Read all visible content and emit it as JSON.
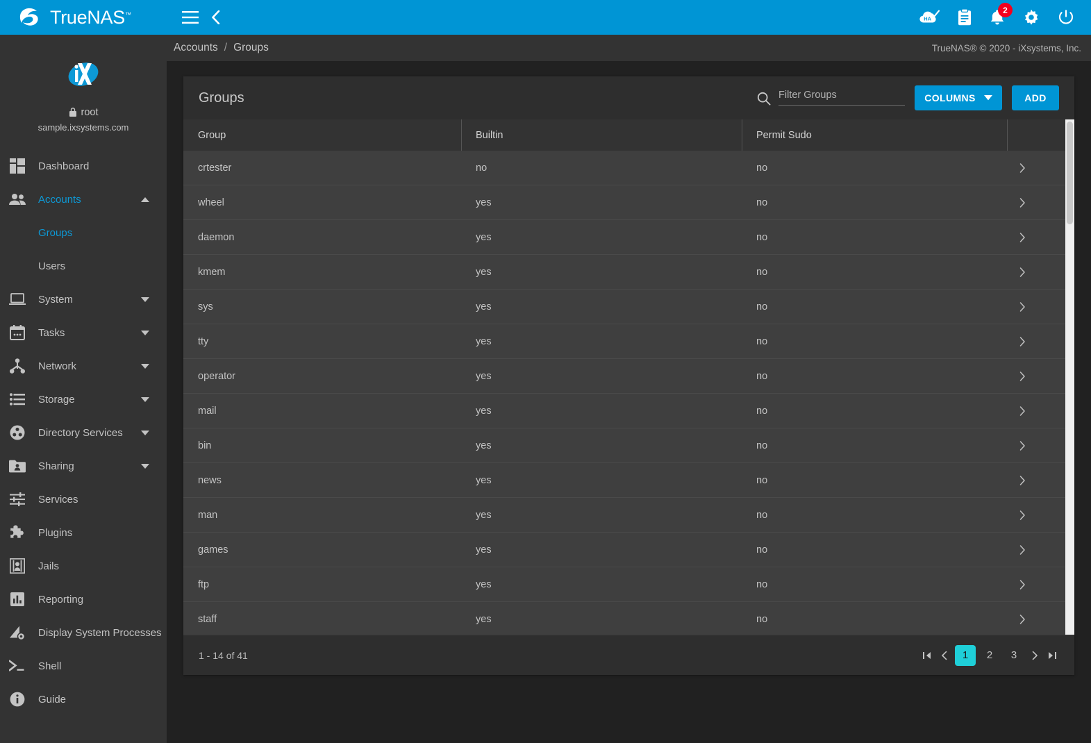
{
  "brand": {
    "name": "TrueNAS",
    "tm": "™"
  },
  "profile": {
    "username": "root",
    "hostname": "sample.ixsystems.com",
    "lock_icon": "lock-icon"
  },
  "topbar": {
    "menu_icon": "hamburger-menu-icon",
    "back_icon": "chevron-left-icon",
    "ha_icon": "ha-cloud-icon",
    "ha_label": "HA",
    "tasks_icon": "clipboard-icon",
    "alerts_icon": "bell-icon",
    "alerts_badge": "2",
    "settings_icon": "gear-icon",
    "power_icon": "power-icon"
  },
  "breadcrumb": {
    "root": "Accounts",
    "separator": "/",
    "current": "Groups"
  },
  "copyright": "TrueNAS® © 2020 - iXsystems, Inc.",
  "sidebar": {
    "items": [
      {
        "label": "Dashboard",
        "icon": "dashboard-icon",
        "expandable": false,
        "active": false
      },
      {
        "label": "Accounts",
        "icon": "accounts-icon",
        "expandable": true,
        "expanded": true,
        "active": true
      },
      {
        "label": "System",
        "icon": "system-icon",
        "expandable": true,
        "expanded": false,
        "active": false
      },
      {
        "label": "Tasks",
        "icon": "tasks-icon",
        "expandable": true,
        "expanded": false,
        "active": false
      },
      {
        "label": "Network",
        "icon": "network-icon",
        "expandable": true,
        "expanded": false,
        "active": false
      },
      {
        "label": "Storage",
        "icon": "storage-icon",
        "expandable": true,
        "expanded": false,
        "active": false
      },
      {
        "label": "Directory Services",
        "icon": "directory-services-icon",
        "expandable": true,
        "expanded": false,
        "active": false
      },
      {
        "label": "Sharing",
        "icon": "sharing-icon",
        "expandable": true,
        "expanded": false,
        "active": false
      },
      {
        "label": "Services",
        "icon": "services-icon",
        "expandable": false,
        "active": false
      },
      {
        "label": "Plugins",
        "icon": "plugins-icon",
        "expandable": false,
        "active": false
      },
      {
        "label": "Jails",
        "icon": "jails-icon",
        "expandable": false,
        "active": false
      },
      {
        "label": "Reporting",
        "icon": "reporting-icon",
        "expandable": false,
        "active": false
      },
      {
        "label": "Display System Processes",
        "icon": "processes-icon",
        "expandable": false,
        "active": false
      },
      {
        "label": "Shell",
        "icon": "shell-icon",
        "expandable": false,
        "active": false
      },
      {
        "label": "Guide",
        "icon": "guide-icon",
        "expandable": false,
        "active": false
      }
    ],
    "subitems": [
      {
        "label": "Groups",
        "active": true
      },
      {
        "label": "Users",
        "active": false
      }
    ]
  },
  "card": {
    "title": "Groups",
    "search": {
      "placeholder": "Filter Groups",
      "value": "",
      "icon": "search-icon"
    },
    "columns_button": {
      "label": "COLUMNS",
      "icon": "chevron-down-icon"
    },
    "add_button": {
      "label": "ADD"
    }
  },
  "table": {
    "headers": [
      "Group",
      "Builtin",
      "Permit Sudo",
      ""
    ],
    "rows": [
      {
        "group": "crtester",
        "builtin": "no",
        "permit_sudo": "no"
      },
      {
        "group": "wheel",
        "builtin": "yes",
        "permit_sudo": "no"
      },
      {
        "group": "daemon",
        "builtin": "yes",
        "permit_sudo": "no"
      },
      {
        "group": "kmem",
        "builtin": "yes",
        "permit_sudo": "no"
      },
      {
        "group": "sys",
        "builtin": "yes",
        "permit_sudo": "no"
      },
      {
        "group": "tty",
        "builtin": "yes",
        "permit_sudo": "no"
      },
      {
        "group": "operator",
        "builtin": "yes",
        "permit_sudo": "no"
      },
      {
        "group": "mail",
        "builtin": "yes",
        "permit_sudo": "no"
      },
      {
        "group": "bin",
        "builtin": "yes",
        "permit_sudo": "no"
      },
      {
        "group": "news",
        "builtin": "yes",
        "permit_sudo": "no"
      },
      {
        "group": "man",
        "builtin": "yes",
        "permit_sudo": "no"
      },
      {
        "group": "games",
        "builtin": "yes",
        "permit_sudo": "no"
      },
      {
        "group": "ftp",
        "builtin": "yes",
        "permit_sudo": "no"
      },
      {
        "group": "staff",
        "builtin": "yes",
        "permit_sudo": "no"
      }
    ],
    "row_expand_icon": "chevron-right-icon"
  },
  "paginator": {
    "range": "1 - 14 of 41",
    "first_icon": "first-page-icon",
    "prev_icon": "prev-page-icon",
    "pages": [
      "1",
      "2",
      "3"
    ],
    "active_page": "1",
    "next_icon": "next-page-icon",
    "last_icon": "last-page-icon"
  },
  "colors": {
    "brand_blue": "#0095d5",
    "accent_link": "#0d99d6",
    "pager_active": "#1fcfd8",
    "badge_red": "#f4001d",
    "sidebar_bg": "#333333",
    "card_bg": "#2e2e2e",
    "row_bg": "#3f3f3f",
    "page_bg": "#212121"
  }
}
